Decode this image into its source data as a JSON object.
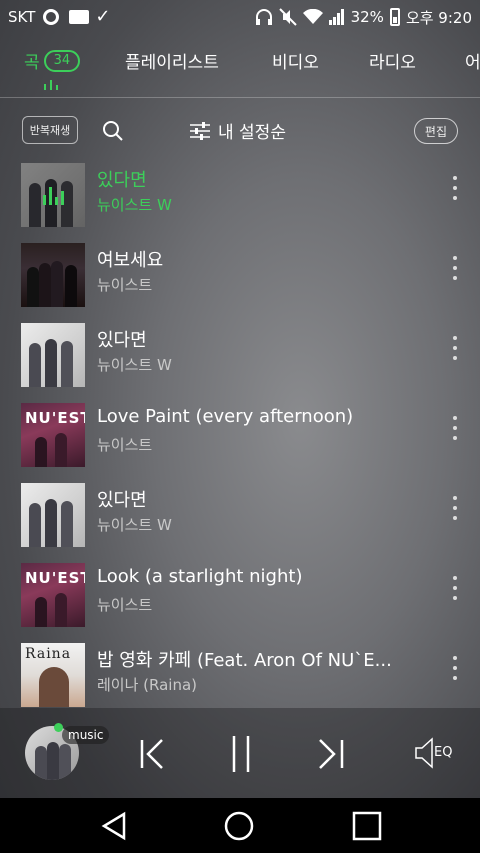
{
  "status_bar": {
    "carrier": "SKT",
    "battery": "32%",
    "time": "오후 9:20",
    "icons": [
      "circle-notification-icon",
      "mail-icon",
      "download-done-icon",
      "headphones-icon",
      "mute-icon",
      "wifi-icon",
      "signal-icon",
      "battery-icon"
    ]
  },
  "tabs": [
    {
      "label": "곡",
      "badge": "34",
      "active": true
    },
    {
      "label": "플레이리스트"
    },
    {
      "label": "비디오"
    },
    {
      "label": "라디오"
    },
    {
      "label": "어"
    }
  ],
  "toolbar": {
    "repeat_label": "반복재생",
    "sort_label": "내 설정순",
    "edit_label": "편집"
  },
  "tracks": [
    {
      "title": "있다면",
      "artist": "뉴이스트 W",
      "playing": true
    },
    {
      "title": "여보세요",
      "artist": "뉴이스트"
    },
    {
      "title": "있다면",
      "artist": "뉴이스트 W"
    },
    {
      "title": "Love Paint (every afternoon)",
      "artist": "뉴이스트",
      "art_text": "NU'EST"
    },
    {
      "title": "있다면",
      "artist": "뉴이스트 W"
    },
    {
      "title": "Look (a starlight night)",
      "artist": "뉴이스트",
      "art_text": "NU'EST"
    },
    {
      "title": "밥 영화 카페 (Feat. Aron Of NU`E...",
      "artist": "레이나 (Raina)",
      "art_text": "Raina"
    }
  ],
  "player": {
    "tag": "music",
    "eq_label": "EQ"
  },
  "colors": {
    "accent": "#3ccf5a"
  }
}
